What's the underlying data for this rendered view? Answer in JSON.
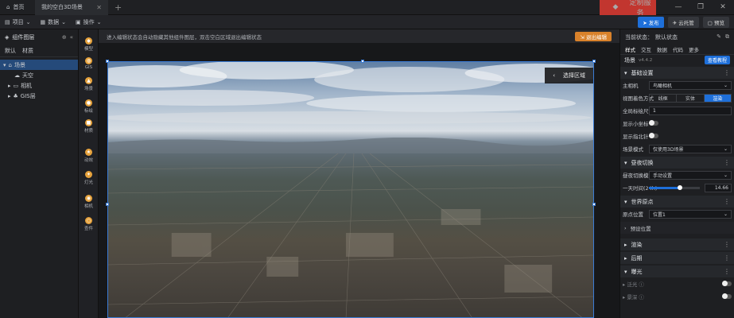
{
  "titlebar": {
    "home_tab": "首页",
    "active_tab": "我的空白3D场景",
    "plus": "+",
    "service_badge": "定制服务",
    "win_min": "—",
    "win_max": "❐",
    "win_close": "✕"
  },
  "toolbar": {
    "project": "项目",
    "data": "数据",
    "operate": "操作",
    "publish": "发布",
    "cloud": "云托管",
    "preview": "预览"
  },
  "left_panel": {
    "title": "组件图层",
    "tabs": [
      "默认",
      "材质"
    ],
    "tree": [
      {
        "label": "场景",
        "level": 0,
        "selected": true
      },
      {
        "label": "天空",
        "level": 1,
        "selected": false
      },
      {
        "label": "相机",
        "level": 1,
        "selected": false
      },
      {
        "label": "GIS层",
        "level": 1,
        "selected": false
      }
    ]
  },
  "icon_bar": [
    "模型",
    "GIS",
    "场景",
    "标绘",
    "材质",
    "动效",
    "灯光",
    "相机",
    "查件"
  ],
  "stage": {
    "notice": "进入编辑状态会自动隐藏其他组件图层，双击空白区域退出编辑状态",
    "exit_button": "退出编辑",
    "select_area": "选择区域",
    "select_back": "‹"
  },
  "right_panel": {
    "status_label": "当前状态：",
    "status_value": "默认状态",
    "tabs": [
      "样式",
      "交互",
      "数据",
      "代码",
      "更多"
    ],
    "title": "场景",
    "version": "v4.4.2",
    "doc_button": "查看教程",
    "sections": {
      "basic": "基础设置",
      "daynight": "昼夜切换",
      "origin": "世界原点",
      "render": "渲染",
      "post": "后期",
      "exposure": "曝光",
      "effect1": "泛光",
      "effect2": "景深"
    },
    "props": {
      "main_camera_label": "主相机",
      "main_camera_value": "鸟瞰相机",
      "view_mode_label": "视图着色方式",
      "view_modes": [
        "线框",
        "实体",
        "渲染"
      ],
      "scale_label": "全局标绘尺寸",
      "scale_value": "1",
      "show_coord_label": "显示小坐标",
      "show_compass_label": "显示指北针",
      "scene_mode_label": "场景模式",
      "scene_mode_value": "仅使用3D场景",
      "daynight_mode_label": "昼夜切换模式",
      "daynight_mode_value": "手动设置",
      "time_label": "一天时间(24h)",
      "time_value": "14.66",
      "time_fraction": 0.611,
      "origin_label": "原点位置",
      "origin_value": "位置1",
      "preset_label": "预设位置"
    }
  },
  "colors": {
    "accent": "#1e6fd9",
    "exit": "#d9822b",
    "badge": "#c2362f"
  }
}
